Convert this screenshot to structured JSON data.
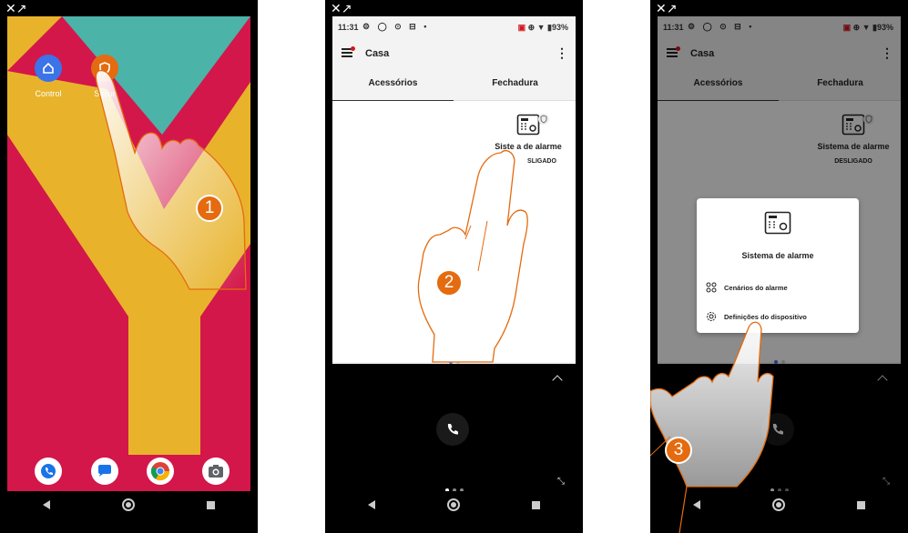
{
  "phone1": {
    "apps": [
      {
        "label": "Control",
        "icon": "home-icon",
        "color": "#3b73e8"
      },
      {
        "label": "Secur",
        "icon": "shield-icon",
        "color": "#e46b0f"
      }
    ],
    "dock": [
      "phone-icon",
      "messages-icon",
      "chrome-icon",
      "camera-icon"
    ],
    "step": "1",
    "wallpaper_colors": {
      "red": "#d3174a",
      "yellow": "#e8b32b",
      "teal": "#4cb3a8"
    }
  },
  "phone2": {
    "status": {
      "time": "11:31",
      "battery": "93%"
    },
    "appbar_title": "Casa",
    "tabs": [
      "Acessórios",
      "Fechadura"
    ],
    "device": {
      "name": "Sistema de alarme",
      "state": "DESLIGADO"
    },
    "device_name_visible": "Siste    a de alarme",
    "device_state_visible": "SLIGADO",
    "step": "2"
  },
  "phone3": {
    "status": {
      "time": "11:31",
      "battery": "93%"
    },
    "appbar_title": "Casa",
    "tabs": [
      "Acessórios",
      "Fechadura"
    ],
    "device": {
      "name": "Sistema de alarme",
      "state": "DESLIGADO"
    },
    "dialog": {
      "title": "Sistema de alarme",
      "options": [
        {
          "label": "Cenários do alarme",
          "icon": "grid-icon"
        },
        {
          "label": "Definições do dispositivo",
          "icon": "gear-icon"
        }
      ]
    },
    "step": "3"
  },
  "accent": "#e46b0f"
}
